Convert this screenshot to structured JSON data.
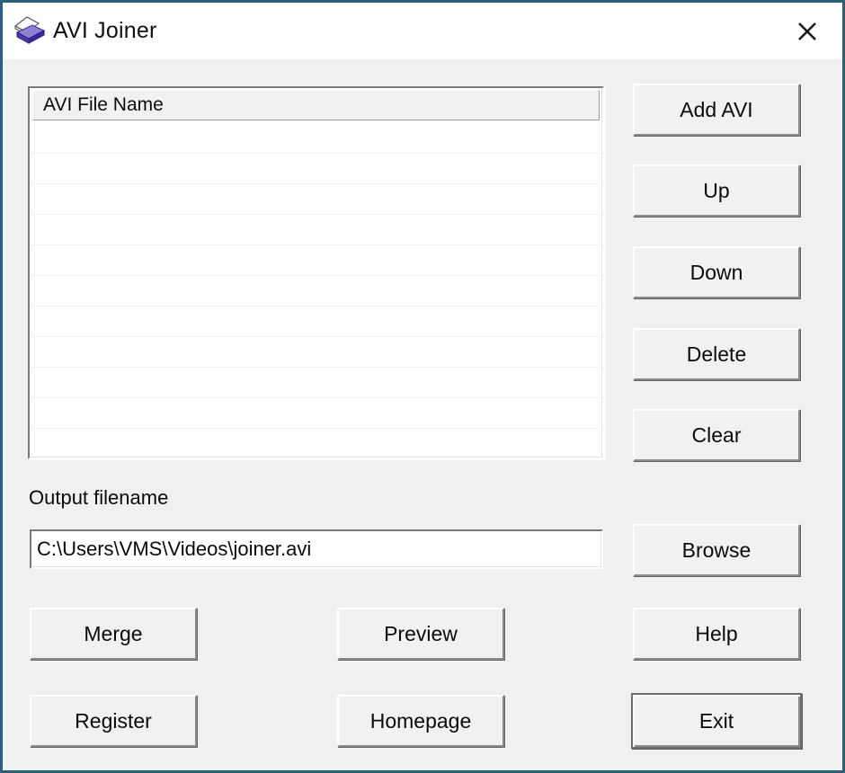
{
  "window": {
    "title": "AVI Joiner",
    "icon": "avi-joiner-icon",
    "close_label": "close-icon",
    "border_color": "#2e5f7a",
    "body_color": "#f0f0f0",
    "titlebar_color": "#ffffff"
  },
  "file_list": {
    "column_header": "AVI File Name",
    "rows": [
      "",
      "",
      "",
      "",
      "",
      "",
      "",
      "",
      "",
      ""
    ]
  },
  "list_actions": {
    "add": "Add AVI",
    "up": "Up",
    "down": "Down",
    "delete": "Delete",
    "clear": "Clear"
  },
  "output": {
    "label": "Output filename",
    "value": "C:\\Users\\VMS\\Videos\\joiner.avi",
    "placeholder": "C:\\Users\\VMS\\Videos\\joiner.avi",
    "browse": "Browse"
  },
  "actions": {
    "merge": "Merge",
    "preview": "Preview",
    "help": "Help",
    "register": "Register",
    "homepage": "Homepage",
    "exit": "Exit"
  }
}
